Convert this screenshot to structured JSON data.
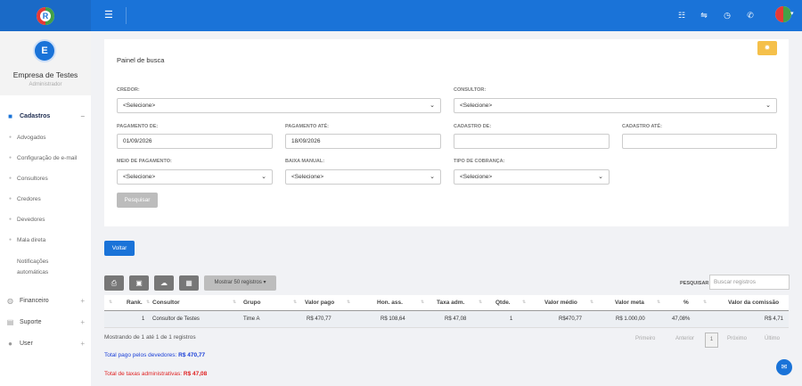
{
  "brand": {
    "logo_letter": "R"
  },
  "topbar": {
    "icons": [
      "menu-icon",
      "list-icon",
      "handshake-icon",
      "clock-icon",
      "whatsapp-icon"
    ],
    "brand_color": "#1a73d8"
  },
  "profile": {
    "initial": "E",
    "name": "Empresa de Testes",
    "role": "Administrador"
  },
  "sidebar": {
    "sections": [
      {
        "label": "Cadastros",
        "icon": "folder-icon",
        "toggle": "−"
      },
      {
        "label": "Financeiro",
        "icon": "money-icon",
        "toggle": "+"
      },
      {
        "label": "Suporte",
        "icon": "support-icon",
        "toggle": "+"
      },
      {
        "label": "User",
        "icon": "user-icon",
        "toggle": "+"
      }
    ],
    "cadastros_items": [
      "Advogados",
      "Configuração de e-mail",
      "Consultores",
      "Credores",
      "Devedores",
      "Mala direta",
      "Notificações",
      "automáticas"
    ]
  },
  "panel": {
    "title": "Painel de busca",
    "labels": {
      "credor": "CREDOR:",
      "consultor": "CONSULTOR:",
      "pagamento_de": "PAGAMENTO DE:",
      "pagamento_ate": "PAGAMENTO ATÉ:",
      "cadastro_de": "CADASTRO DE:",
      "cadastro_ate": "CADASTRO ATÉ:",
      "meio_pagamento": "MEIO DE PAGAMENTO:",
      "baixa_manual": "BAIXA MANUAL:",
      "tipo_cobranca": "TIPO DE COBRANÇA:"
    },
    "values": {
      "credor": "<Selecione>",
      "consultor": "<Selecione>",
      "pagamento_de": "01/09/2026",
      "pagamento_ate": "18/09/2026",
      "cadastro_de": "",
      "cadastro_ate": "",
      "meio_pagamento": "<Selecione>",
      "baixa_manual": "<Selecione>",
      "tipo_cobranca": "<Selecione>"
    },
    "search_button": "Pesquisar"
  },
  "back_button": "Voltar",
  "toolbar": {
    "show_label": "Mostrar 50 registros ▾",
    "search_label": "PESQUISAR",
    "search_placeholder": "Buscar registros"
  },
  "table": {
    "headers": [
      "Rank.",
      "Consultor",
      "Grupo",
      "Valor pago",
      "Hon. ass.",
      "Taxa adm.",
      "Qtde.",
      "Valor médio",
      "Valor meta",
      "%",
      "Valor da comissão"
    ],
    "rows": [
      [
        "1",
        "Consultor de Testes",
        "Time A",
        "R$ 470,77",
        "R$ 108,64",
        "R$ 47,08",
        "1",
        "R$470,77",
        "R$ 1.000,00",
        "47,08%",
        "R$ 4,71"
      ]
    ]
  },
  "footer": {
    "showing": "Mostrando de 1 até 1 de 1 registros",
    "pagination": {
      "first": "Primeiro",
      "prev": "Anterior",
      "current": "1",
      "next": "Próximo",
      "last": "Último"
    },
    "total_pago_label": "Total pago pelos devedores:",
    "total_pago_value": "R$ 470,77",
    "total_taxas_label": "Total de taxas administrativas:",
    "total_taxas_value": "R$ 47,08"
  }
}
